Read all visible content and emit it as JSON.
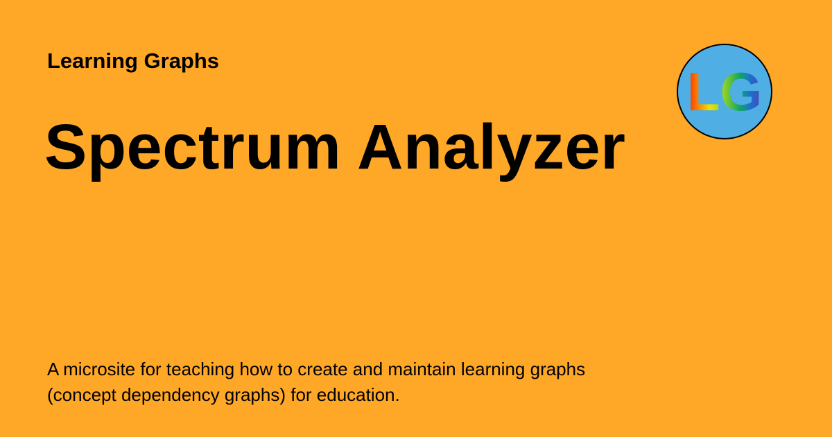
{
  "site_name": "Learning Graphs",
  "page_title": "Spectrum Analyzer",
  "description": "A microsite for teaching how to create and maintain learning graphs (concept dependency graphs) for education.",
  "logo": {
    "text": "LG",
    "circle_color": "#4FAEE3",
    "border_color": "#000000"
  },
  "colors": {
    "background": "#FFA726",
    "text": "#000000"
  }
}
